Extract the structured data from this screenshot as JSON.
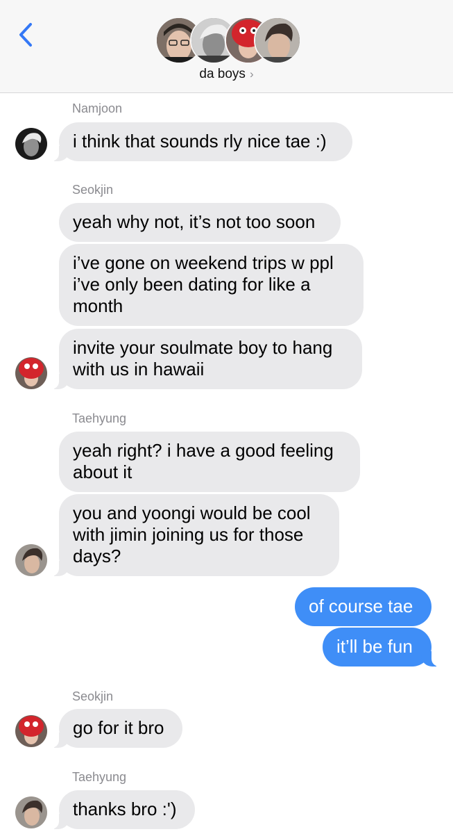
{
  "header": {
    "group_name": "da boys",
    "chevron": "›",
    "back_icon": "chevron-left-icon",
    "accent_color": "#3478f6"
  },
  "thread": {
    "senders": [
      "Namjoon",
      "Seokjin",
      "Taehyung",
      "Seokjin",
      "Taehyung"
    ],
    "messages": [
      "i think that sounds rly nice tae :)",
      "yeah why not, it’s not too soon",
      "i’ve gone on weekend trips w ppl i’ve only been dating for like a month",
      "invite your soulmate boy to hang with us in hawaii",
      "yeah right? i have a good feeling about it",
      "you and yoongi would be cool with jimin joining us for those days?",
      "of course tae",
      "it’ll be fun",
      "go for it bro",
      "thanks bro :')"
    ]
  },
  "colors": {
    "incoming_bubble": "#e9e9eb",
    "outgoing_bubble": "#3f8ef7",
    "sender_label": "#8a8a8f"
  }
}
